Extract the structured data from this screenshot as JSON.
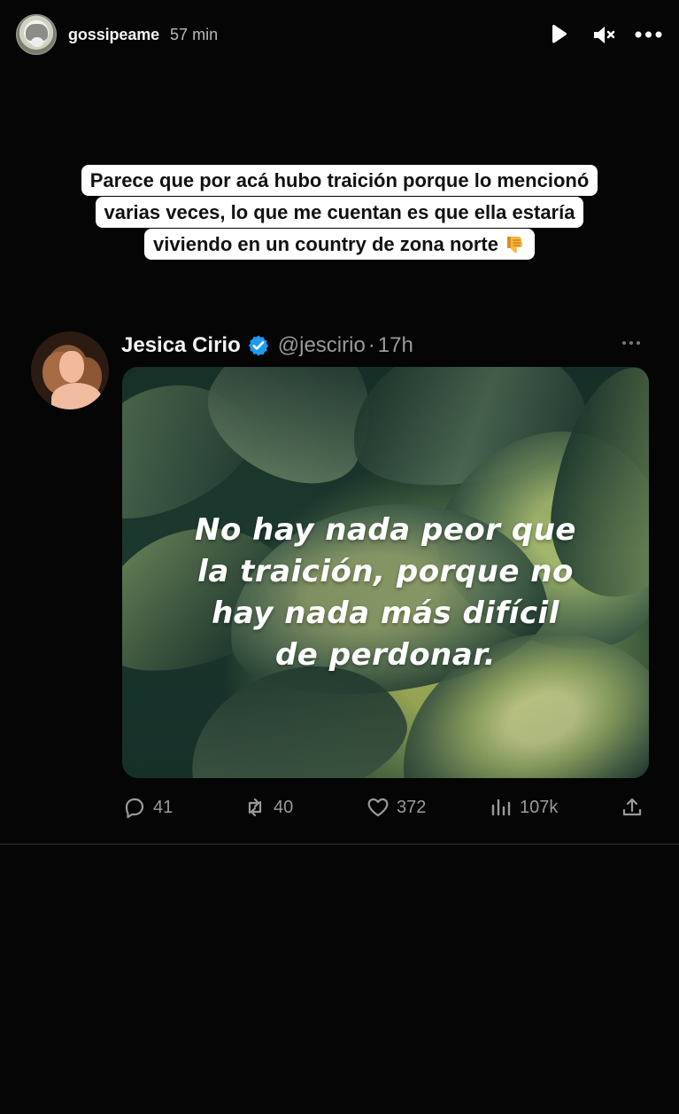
{
  "story": {
    "username": "gossipeame",
    "time": "57 min",
    "controls": {
      "play_icon": "play-icon",
      "mute_icon": "muted-speaker-icon",
      "more_icon": "more-horizontal-icon"
    },
    "caption": {
      "lines": [
        "Parece que por acá hubo traición porque lo mencionó",
        "varias veces, lo que me cuentan es que ella estaría",
        "viviendo en un country de zona norte"
      ],
      "emoji": "thumbs-down-emoji"
    }
  },
  "tweet": {
    "display_name": "Jesica Cirio",
    "handle": "@jescirio",
    "separator": "·",
    "time": "17h",
    "verified_icon": "verified-badge-icon",
    "media_text": "No hay nada peor que\nla traición, porque no\nhay nada más difícil\nde perdonar.",
    "actions": {
      "replies": "41",
      "retweets": "40",
      "likes": "372",
      "views": "107k"
    }
  },
  "colors": {
    "background": "#050505",
    "caption_background": "#ffffff",
    "muted_text": "#9a9a9a",
    "verified_blue": "#1d9bf0"
  }
}
